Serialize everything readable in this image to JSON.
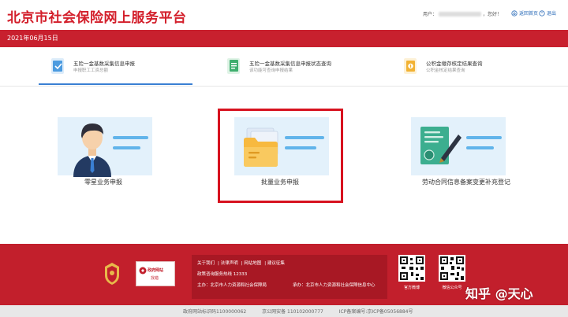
{
  "header": {
    "title": "北京市社会保险网上服务平台",
    "user_prefix": "用户：",
    "user_suffix": "，您好！",
    "links": [
      {
        "label": "返回首页"
      },
      {
        "label": "退出"
      }
    ]
  },
  "date_bar": {
    "date": "2021年06月15日"
  },
  "tabs": [
    {
      "title": "五险一金基数采集信息申报",
      "subtitle": "申报职工工资总额"
    },
    {
      "title": "五险一金基数采集信息申报状态查询",
      "subtitle": "该功能可查询申报结果"
    },
    {
      "title": "公积金缴存核定结果查询",
      "subtitle": "公积金核定结果查询"
    }
  ],
  "cards": [
    {
      "label": "零星业务申报"
    },
    {
      "label": "批量业务申报"
    },
    {
      "label": "劳动合同信息备案变更补充登记"
    }
  ],
  "footer": {
    "gov_badge": {
      "line1": "政府网站",
      "line2": "找错"
    },
    "links": [
      "关于我们",
      "法律声明",
      "网站地图",
      "建议征集"
    ],
    "hotline": "政策咨询服务热线 12333",
    "sponsor": "主办：北京市人力资源和社会保障局",
    "operator": "承办：北京市人力资源和社会保障信息中心",
    "qr_labels": [
      "官方微博",
      "微信公众号"
    ],
    "bottom": [
      "政府网站标识码1100000062",
      "京公网安备 110102000777",
      "ICP备案编号:京ICP备05056884号"
    ]
  },
  "watermark": "知乎 @天心",
  "colors": {
    "brand_red": "#c8202e",
    "accent_blue": "#3a7fd3",
    "highlight": "#d7121f"
  }
}
